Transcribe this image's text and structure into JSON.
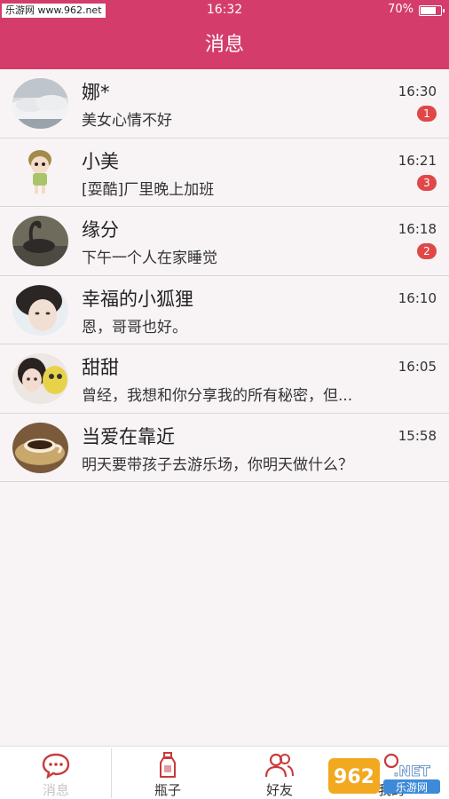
{
  "status_bar": {
    "watermark": "乐游网 www.962.net",
    "time": "16:32",
    "battery": "70%",
    "battery_level": 0.7
  },
  "header": {
    "title": "消息"
  },
  "conversations": [
    {
      "name": "娜*",
      "message": "美女心情不好",
      "time": "16:30",
      "unread": "1",
      "avatar": "avatar-cloud"
    },
    {
      "name": "小美",
      "message": "[耍酷]厂里晚上加班",
      "time": "16:21",
      "unread": "3",
      "avatar": "avatar-doll"
    },
    {
      "name": "缘分",
      "message": "下午一个人在家睡觉",
      "time": "16:18",
      "unread": "2",
      "avatar": "avatar-swan"
    },
    {
      "name": "幸福的小狐狸",
      "message": "恩，哥哥也好。",
      "time": "16:10",
      "unread": "",
      "avatar": "avatar-girl"
    },
    {
      "name": "甜甜",
      "message": "曾经，我想和你分享我的所有秘密，但...",
      "time": "16:05",
      "unread": "",
      "avatar": "avatar-girl-toy"
    },
    {
      "name": "当爱在靠近",
      "message": "明天要带孩子去游乐场，你明天做什么？",
      "time": "15:58",
      "unread": "",
      "avatar": "avatar-coffee"
    }
  ],
  "tabs": [
    {
      "label": "消息",
      "icon": "chat-bubble-icon",
      "active": true
    },
    {
      "label": "瓶子",
      "icon": "bottle-icon",
      "active": false
    },
    {
      "label": "好友",
      "icon": "friends-icon",
      "active": false
    },
    {
      "label": "我的",
      "icon": "profile-icon",
      "active": false
    }
  ],
  "watermark_bottom": {
    "text": "962.NET",
    "subtext": "乐游网"
  },
  "colors": {
    "brand": "#d43d6b",
    "badge": "#e04848",
    "tab_icon": "#c93a3a"
  }
}
